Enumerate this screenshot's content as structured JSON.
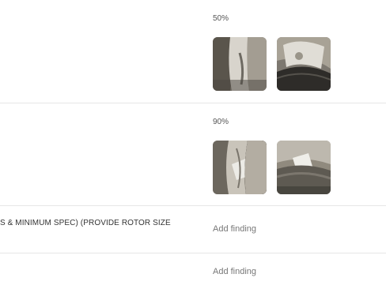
{
  "findings": [
    {
      "percent": "50%",
      "photos": [
        {
          "icon": "rotor-photo-thumbnail"
        },
        {
          "icon": "rotor-photo-thumbnail"
        }
      ]
    },
    {
      "percent": "90%",
      "photos": [
        {
          "icon": "rotor-photo-thumbnail"
        },
        {
          "icon": "rotor-photo-thumbnail"
        }
      ]
    }
  ],
  "items": [
    {
      "label": "S & MINIMUM SPEC) (PROVIDE ROTOR SIZE",
      "action_label": "Add finding"
    },
    {
      "label": "",
      "action_label": "Add finding"
    }
  ],
  "colors": {
    "divider": "#e6e6e6",
    "action_text": "#777777"
  }
}
